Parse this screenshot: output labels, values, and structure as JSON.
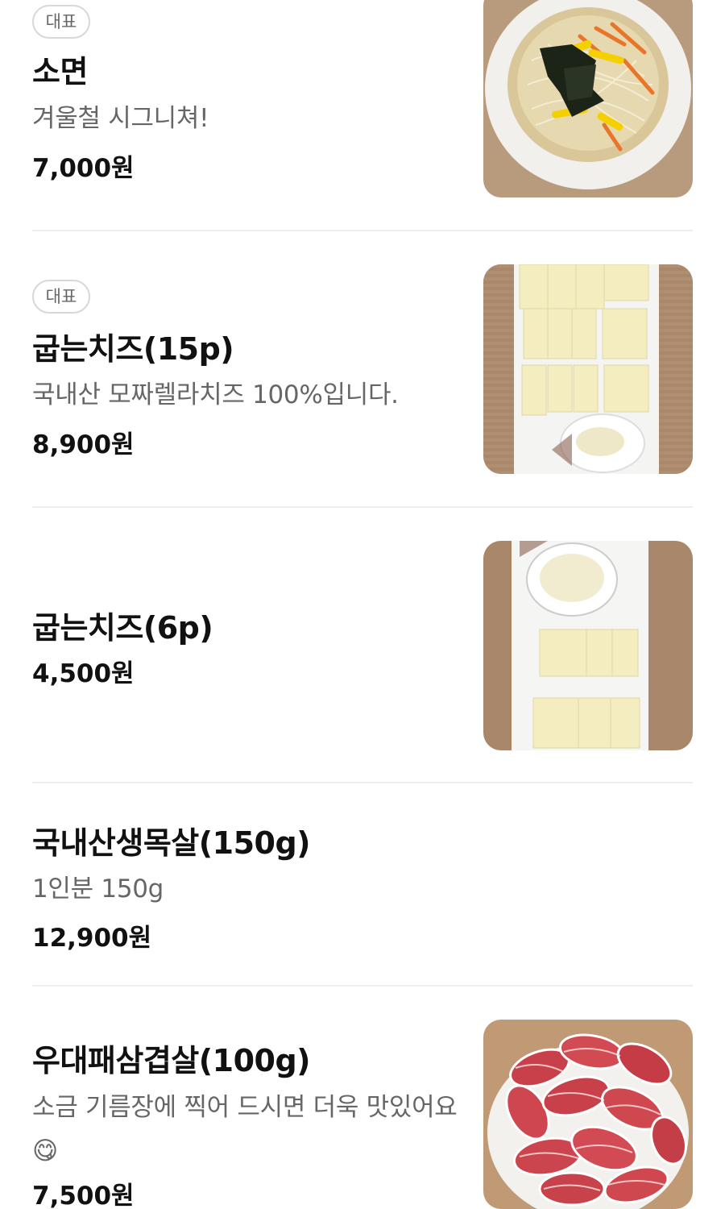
{
  "menu": [
    {
      "badge": "대표",
      "name": "소면",
      "desc": "겨울철 시그니쳐!",
      "price": "7,000원",
      "photo": "noodle-soup-photo"
    },
    {
      "badge": "대표",
      "name": "굽는치즈(15p)",
      "desc": "국내산 모짜렐라치즈 100%입니다.",
      "price": "8,900원",
      "photo": "cheese-platter-photo"
    },
    {
      "name": "굽는치즈(6p)",
      "price": "4,500원",
      "photo": "cheese-platter-small-photo"
    },
    {
      "name": "국내산생목살(150g)",
      "desc": "1인분 150g",
      "price": "12,900원"
    },
    {
      "name": "우대패삼겹살(100g)",
      "desc": "소금 기름장에 찍어 드시면 더욱 맛있어요😋",
      "price": "7,500원",
      "photo": "pork-belly-photo"
    }
  ],
  "colors": {
    "name_text": "#111111",
    "desc_text": "#666666",
    "badge_border": "#d8d8d8",
    "divider": "#eeeeee"
  }
}
